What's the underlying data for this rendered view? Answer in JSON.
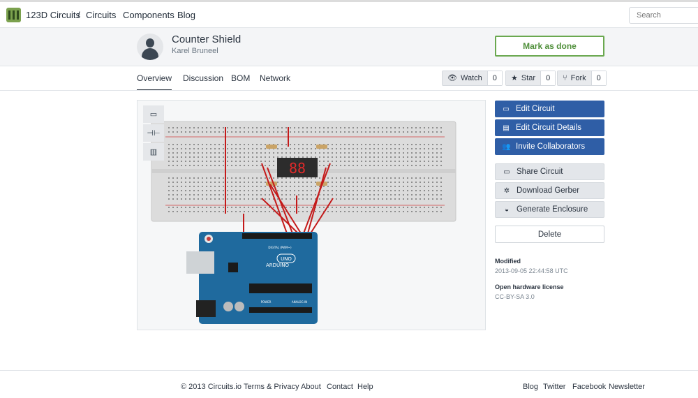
{
  "nav": {
    "brand": "123D Circuits",
    "separator": "/",
    "links": [
      "Circuits",
      "Components",
      "Blog"
    ],
    "search_placeholder": "Search"
  },
  "project": {
    "title": "Counter Shield",
    "author": "Karel Bruneel",
    "mark_done_label": "Mark as done"
  },
  "tabs": [
    "Overview",
    "Discussion",
    "BOM",
    "Network"
  ],
  "social": {
    "watch": {
      "label": "Watch",
      "count": "0",
      "icon": "eye-icon"
    },
    "star": {
      "label": "Star",
      "count": "0",
      "icon": "star-icon"
    },
    "fork": {
      "label": "Fork",
      "count": "0",
      "icon": "fork-icon"
    }
  },
  "actions": {
    "primary": [
      {
        "label": "Edit Circuit",
        "icon": "window-icon"
      },
      {
        "label": "Edit Circuit Details",
        "icon": "id-card-icon"
      },
      {
        "label": "Invite Collaborators",
        "icon": "users-icon"
      }
    ],
    "secondary": [
      {
        "label": "Share Circuit",
        "icon": "window-icon"
      },
      {
        "label": "Download Gerber",
        "icon": "gear-arrow-icon"
      },
      {
        "label": "Generate Enclosure",
        "icon": "enclosure-icon"
      }
    ],
    "delete_label": "Delete"
  },
  "meta": {
    "modified_label": "Modified",
    "modified_value": "2013-09-05 22:44:58 UTC",
    "license_label": "Open hardware license",
    "license_value": "CC-BY-SA 3.0"
  },
  "board": {
    "display_text": "88",
    "arduino_label": "ARDUINO",
    "uno_label": "UNO",
    "digital_label": "DIGITAL (PWM~)",
    "analog_label": "ANALOG IN",
    "power_label": "POWER"
  },
  "footer": {
    "left": [
      "© 2013 Circuits.io",
      "Terms & Privacy",
      "About",
      "Contact",
      "Help"
    ],
    "right": [
      "Blog",
      "Twitter",
      "Facebook",
      "Newsletter"
    ]
  },
  "colors": {
    "primary_blue": "#2f5ea6",
    "green": "#6aa84f",
    "wire_red": "#c41a1a",
    "arduino_blue": "#1f6a9e"
  }
}
